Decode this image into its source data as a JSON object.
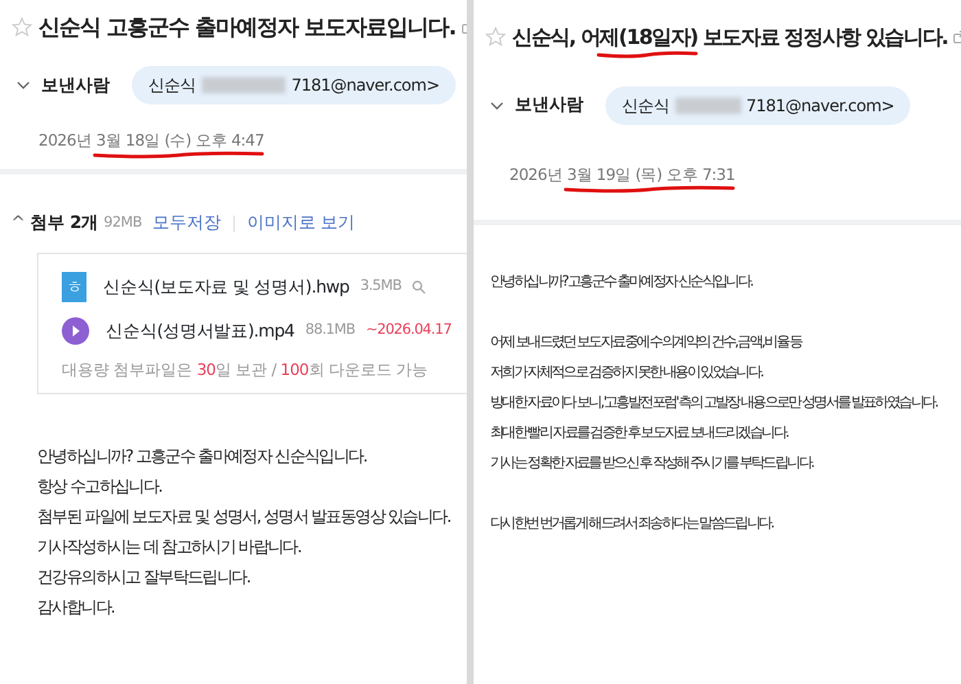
{
  "emails": [
    {
      "starred": false,
      "subject_parts": [
        {
          "text": "신순식 고흥군수 출마예정자 보도자료입니다.",
          "underlined": false
        }
      ],
      "sender_label": "보낸사람",
      "sender_name": "신순식",
      "sender_email": "7181@naver.com>",
      "date_parts": [
        {
          "text": "2026년 ",
          "underlined": false
        },
        {
          "text": "3월 18일 (수) 오후 4:47",
          "underlined": true
        }
      ],
      "attachments": {
        "expanded": true,
        "caret": "^",
        "title": "첨부 2개",
        "size": "92MB",
        "save_all": "모두저장",
        "view_as_image": "이미지로 보기",
        "files": [
          {
            "kind": "hwp",
            "icon_text": "ㅎ",
            "name": "신순식(보도자료 및 성명서).hwp",
            "size": "3.5MB"
          },
          {
            "kind": "video",
            "name": "신순식(성명서발표).mp4",
            "size": "88.1MB",
            "expiry": "~2026.04.17"
          }
        ],
        "note_parts": [
          {
            "text": "대용량 첨부파일은 ",
            "highlight": false
          },
          {
            "text": "30",
            "highlight": true
          },
          {
            "text": "일 보관 / ",
            "highlight": false
          },
          {
            "text": "100",
            "highlight": true
          },
          {
            "text": "회 다운로드 가능",
            "highlight": false
          }
        ]
      },
      "body": [
        [
          "안녕하십니까? 고흥군수 출마예정자 신순식입니다.",
          "항상 수고하십니다.",
          "첨부된 파일에 보도자료 및 성명서, 성명서 발표동영상 있습니다.",
          "기사작성하시는 데 참고하시기 바랍니다.",
          "건강유의하시고 잘부탁드립니다.",
          "감사합니다."
        ]
      ]
    },
    {
      "starred": false,
      "subject_parts": [
        {
          "text": "신순식, 어",
          "underlined": false
        },
        {
          "text": "제(18일자)",
          "underlined": true
        },
        {
          "text": " 보도자료 정정사항 있습니다.",
          "underlined": false
        }
      ],
      "sender_label": "보낸사람",
      "sender_name": "신순식",
      "sender_email": "7181@naver.com>",
      "date_parts": [
        {
          "text": "2026년 ",
          "underlined": false
        },
        {
          "text": "3월 19일 (목) 오후 7:31",
          "underlined": true
        }
      ],
      "body": [
        [
          "안녕하십니까? 고흥군수 출마예정자 신순식입니다."
        ],
        [
          "어제 보내드렸던 보도자료중에 수의계약의 건수, 금액, 비율 등",
          "저희가 자체적으로 검증하지 못한 내용이 있었습니다.",
          "방대한 자료이다 보니, '고흥발전포럼' 측의 고발장 내용으로만 성명서를 발표하였습니다.",
          "최대한 빨리 자료를 검증한 후 보도자료 보내드리겠습니다.",
          "기사는 정확한 자료를 받으신 후 작성해 주시기를 부탁드립니다."
        ],
        [
          "다시한번 번거롭게 해드려서 죄송하다는 말씀드립니다."
        ]
      ]
    }
  ]
}
